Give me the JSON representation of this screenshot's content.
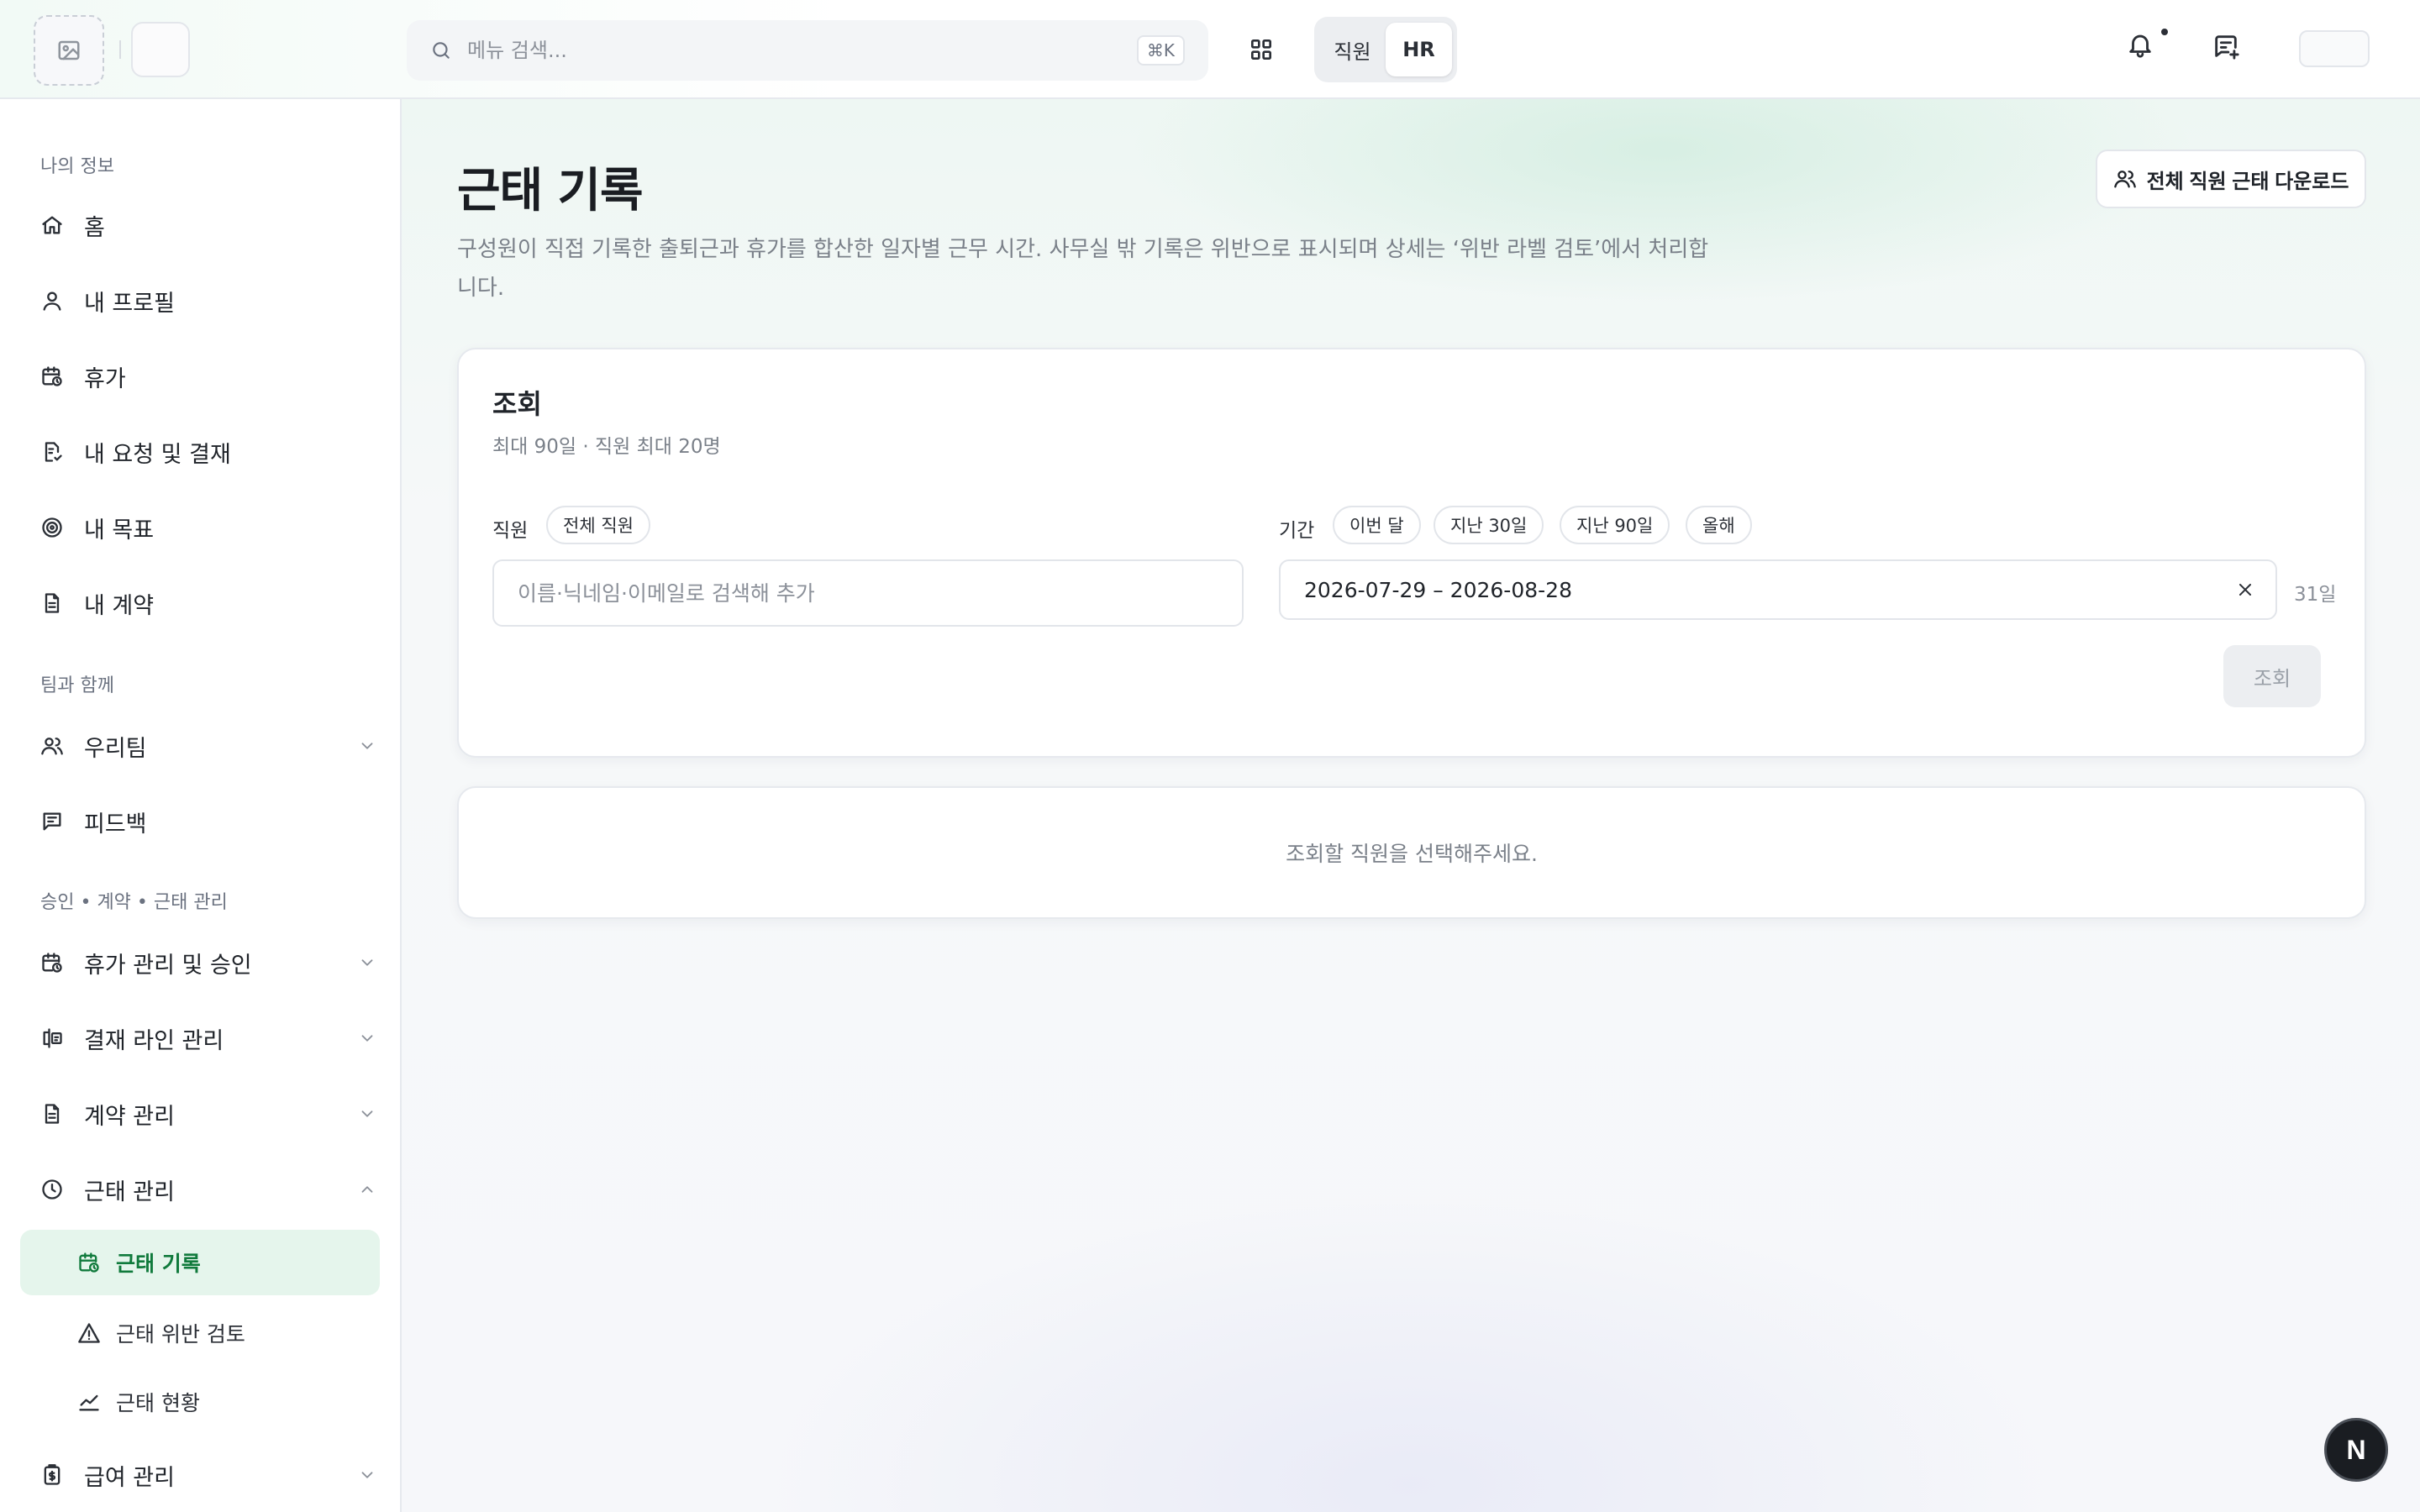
{
  "topbar": {
    "search_placeholder": "메뉴 검색...",
    "shortcut": "⌘K",
    "roles": [
      "직원",
      "HR"
    ],
    "active_role": "HR"
  },
  "sidebar": {
    "sections": {
      "my_info": "나의 정보",
      "team": "팀과 함께",
      "admin": "승인 • 계약 • 근태 관리"
    },
    "items": {
      "home": "홈",
      "profile": "내 프로필",
      "leave": "휴가",
      "requests": "내 요청 및 결재",
      "goals": "내 목표",
      "contracts": "내 계약",
      "our_team": "우리팀",
      "feedback": "피드백",
      "leave_admin": "휴가 관리 및 승인",
      "approval_line": "결재 라인 관리",
      "contract_admin": "계약 관리",
      "attendance_admin": "근태 관리",
      "payroll_admin": "급여 관리"
    },
    "subitems": {
      "attendance_record": "근태 기록",
      "violation_review": "근태 위반 검토",
      "attendance_status": "근태 현황"
    },
    "active": "attendance_record"
  },
  "page": {
    "title": "근태 기록",
    "description": "구성원이 직접 기록한 출퇴근과 휴가를 합산한 일자별 근무 시간. 사무실 밖 기록은 위반으로 표시되며 상세는 ‘위반 라벨 검토’에서 처리합니다.",
    "download_label": "전체 직원 근태 다운로드"
  },
  "query_card": {
    "title": "조회",
    "subtitle": "최대 90일 · 직원 최대 20명",
    "employee_label": "직원",
    "all_employees_chip": "전체 직원",
    "employee_placeholder": "이름·닉네임·이메일로 검색해 추가",
    "period_label": "기간",
    "period_chips": [
      "이번 달",
      "지난 30일",
      "지난 90일",
      "올해"
    ],
    "date_range": "2026-07-29 – 2026-08-28",
    "day_count": "31일",
    "submit_label": "조회"
  },
  "result": {
    "empty_message": "조회할 직원을 선택해주세요."
  },
  "fab_label": "N",
  "colors": {
    "accent": "#107a3c",
    "active_bg": "#e5f5ec"
  }
}
